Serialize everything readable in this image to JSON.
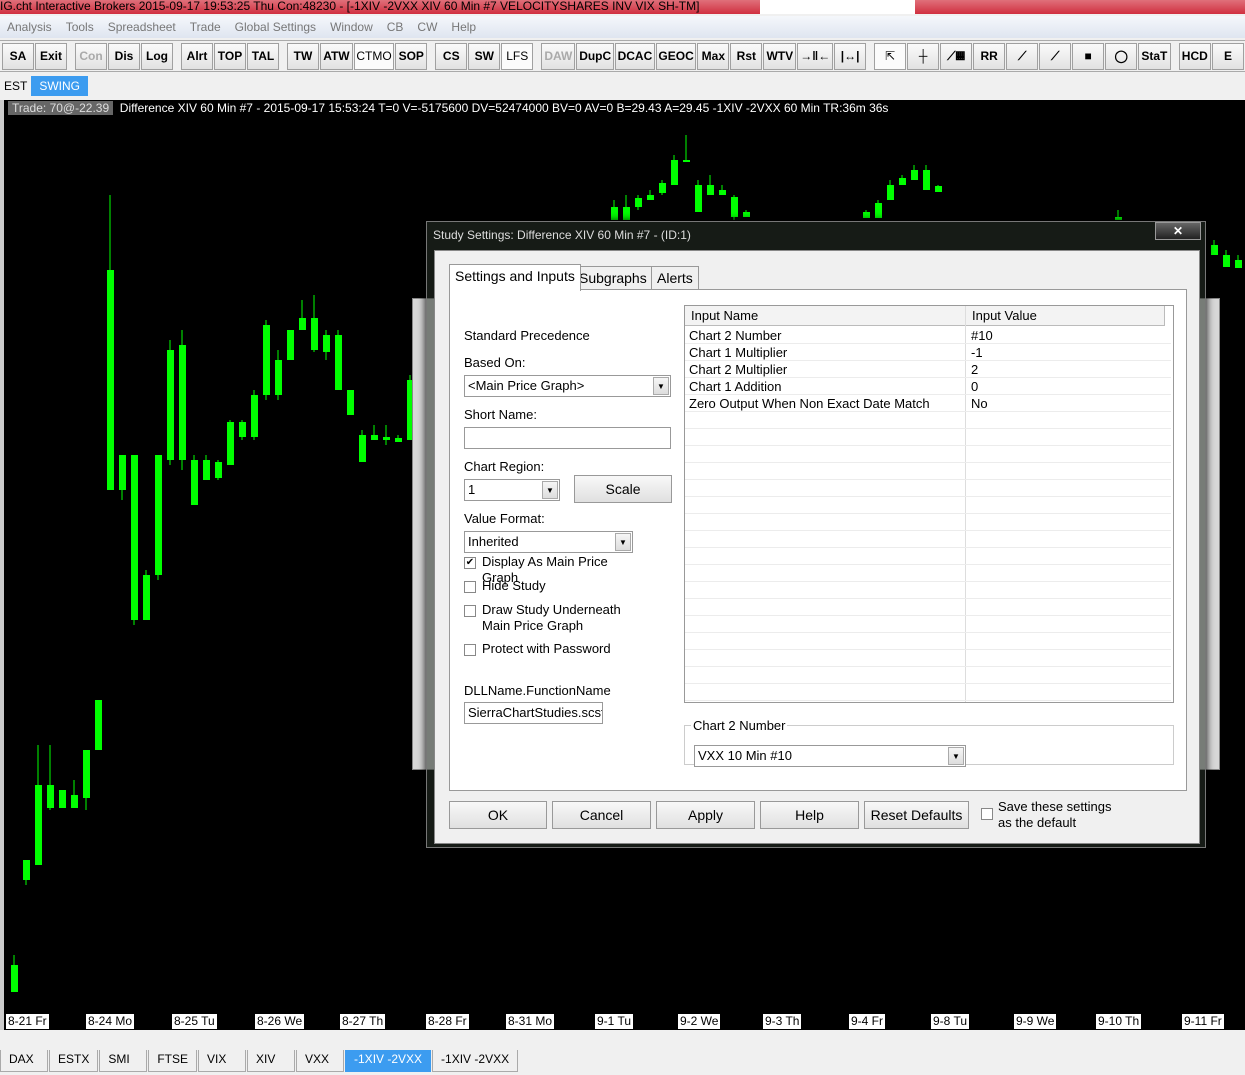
{
  "window": {
    "title": "IG.cht  Interactive Brokers 2015-09-17  19:53:25 Thu  Con:48230 - [-1XIV -2VXX  XIV  60 Min   #7  VELOCITYSHARES INV VIX SH-TM]"
  },
  "menu": [
    "Analysis",
    "Tools",
    "Spreadsheet",
    "Trade",
    "Global Settings",
    "Window",
    "CB",
    "CW",
    "Help"
  ],
  "toolbar": [
    {
      "label": "SA"
    },
    {
      "label": "Exit"
    },
    {
      "label": "Con",
      "dim": true,
      "gap": true
    },
    {
      "label": "Dis"
    },
    {
      "label": "Log"
    },
    {
      "label": "Alrt",
      "gap": true
    },
    {
      "label": "TOP"
    },
    {
      "label": "TAL"
    },
    {
      "label": "TW",
      "gap": true
    },
    {
      "label": "ATW"
    },
    {
      "label": "CTMO",
      "pressed": true
    },
    {
      "label": "SOP"
    },
    {
      "label": "CS",
      "gap": true
    },
    {
      "label": "SW"
    },
    {
      "label": "LFS",
      "pressed": true
    },
    {
      "label": "DAW",
      "dim": true,
      "gap": true
    },
    {
      "label": "DupC"
    },
    {
      "label": "DCAC"
    },
    {
      "label": "GEOC"
    },
    {
      "label": "Max"
    },
    {
      "label": "Rst"
    },
    {
      "label": "WTV"
    },
    {
      "icon": "compress-bars-icon",
      "glyph": "→‖←"
    },
    {
      "icon": "expand-bars-icon",
      "glyph": "|↔|"
    },
    {
      "icon": "pointer-icon",
      "glyph": "⇱",
      "gap": true,
      "pressed": true
    },
    {
      "icon": "crosshair-icon",
      "glyph": "┼"
    },
    {
      "icon": "calculator-line-icon",
      "glyph": "⟋▦"
    },
    {
      "label": "RR"
    },
    {
      "icon": "line-tool-icon",
      "glyph": "⟋"
    },
    {
      "icon": "ray-tool-icon",
      "glyph": "⟋"
    },
    {
      "icon": "rectangle-tool-icon",
      "glyph": "■"
    },
    {
      "icon": "ellipse-tool-icon",
      "glyph": "◯"
    },
    {
      "label": "StaT"
    },
    {
      "label": "HCD",
      "gap": true
    },
    {
      "label": "E"
    }
  ],
  "chartbook_tabs": [
    {
      "label": "EST",
      "active": false
    },
    {
      "label": "SWING",
      "active": true
    }
  ],
  "infobar": {
    "trade": "Trade: 70@-22.39",
    "text": "Difference XIV  60 Min   #7 -  2015-09-17 15:53:24 T=0 V=-5175600 DV=52474000 BV=0 AV=0 B=29.43 A=29.45 -1XIV -2VXX 60 Min  TR:36m 36s"
  },
  "colors": {
    "candle": "#00ff00",
    "background": "#000000",
    "active_tab": "#3c9cf0"
  },
  "chart_data": {
    "type": "candlestick",
    "note": "OHLC in relative price units; values [index, high, bodyTop, bodyBottom, low]",
    "candles": [
      [
        0,
        5.5,
        4.5,
        1.8,
        1.8
      ],
      [
        1,
        15,
        15,
        13,
        12.5
      ],
      [
        2,
        26.5,
        22.5,
        14.5,
        14.5
      ],
      [
        3,
        26.5,
        22.5,
        20.2,
        20
      ],
      [
        4,
        22,
        22,
        20.2,
        20.2
      ],
      [
        5,
        23,
        21.5,
        20.2,
        20.2
      ],
      [
        6,
        26,
        26,
        21.2,
        20
      ],
      [
        7,
        31,
        31,
        26,
        26
      ],
      [
        8,
        81.5,
        74,
        52,
        52
      ],
      [
        9,
        55.5,
        55.5,
        52,
        51
      ],
      [
        10,
        55.5,
        55.5,
        39,
        38.5
      ],
      [
        11,
        44,
        43.5,
        39,
        39
      ],
      [
        12,
        55.5,
        55.5,
        43.5,
        43
      ],
      [
        13,
        67,
        66,
        55,
        54.5
      ],
      [
        14,
        68,
        66.5,
        55,
        54
      ],
      [
        15,
        55.5,
        55,
        50.5,
        50.5
      ],
      [
        16,
        55.5,
        55,
        53,
        53
      ],
      [
        17,
        55,
        54.8,
        53.2,
        53
      ],
      [
        18,
        59,
        58.8,
        54.5,
        54.5
      ],
      [
        19,
        59,
        58.8,
        57.3,
        57
      ],
      [
        20,
        62,
        61.5,
        57.3,
        57
      ],
      [
        21,
        69,
        68.5,
        61.5,
        61
      ],
      [
        22,
        66,
        65,
        61.5,
        61
      ],
      [
        23,
        68,
        68,
        65,
        65
      ],
      [
        24,
        71,
        69.2,
        68,
        68
      ],
      [
        25,
        71.5,
        69.2,
        66,
        65.8
      ],
      [
        26,
        68,
        67.5,
        65.8,
        65
      ],
      [
        27,
        68,
        67.5,
        62,
        62
      ],
      [
        28,
        62,
        62,
        59.5,
        59.5
      ],
      [
        29,
        58,
        57.5,
        54.8,
        54.8
      ],
      [
        30,
        58.5,
        57.5,
        57,
        57
      ],
      [
        31,
        58.5,
        57.3,
        57,
        56.5
      ],
      [
        32,
        57.5,
        57.2,
        56.8,
        56.8
      ],
      [
        33,
        63.5,
        63,
        57,
        57
      ],
      [
        50,
        81,
        80.3,
        79,
        79
      ],
      [
        51,
        81.5,
        80.3,
        79,
        79
      ],
      [
        52,
        81.5,
        81.2,
        80.3,
        80
      ],
      [
        53,
        82,
        81.5,
        81,
        81
      ],
      [
        54,
        83,
        82.7,
        81.7,
        81.5
      ],
      [
        55,
        85.5,
        85,
        82.5,
        82.5
      ],
      [
        56,
        87.5,
        85,
        85,
        85
      ],
      [
        57,
        83,
        82.5,
        79.8,
        79.8
      ],
      [
        58,
        83.5,
        82.5,
        81.5,
        81.5
      ],
      [
        59,
        82.5,
        82,
        81.5,
        81.5
      ],
      [
        60,
        81.5,
        81.3,
        79.3,
        79
      ],
      [
        61,
        80,
        79.8,
        79.3,
        79.3
      ],
      [
        71,
        80,
        79.8,
        79.2,
        79.2
      ],
      [
        72,
        81,
        80.7,
        79.2,
        79.2
      ],
      [
        73,
        83,
        82.5,
        81,
        81
      ],
      [
        74,
        83.5,
        83.2,
        82.5,
        82.5
      ],
      [
        75,
        84.5,
        84,
        83,
        83
      ],
      [
        76,
        84.5,
        84,
        82,
        82
      ],
      [
        77,
        82.5,
        82.4,
        81.8,
        81.8
      ],
      [
        92,
        80,
        79.3,
        79,
        79
      ],
      [
        100,
        77,
        76.5,
        75.5,
        75.5
      ],
      [
        101,
        76,
        75.5,
        74.3,
        74.3
      ],
      [
        102,
        75.5,
        75,
        74.2,
        74.2
      ]
    ],
    "x_tick_labels": [
      "8-21 Fr",
      "8-24 Mo",
      "8-25 Tu",
      "8-26 We",
      "8-27 Th",
      "8-28 Fr",
      "8-31 Mo",
      "9-1 Tu",
      "9-2 We",
      "9-3 Th",
      "9-4 Fr",
      "9-8 Tu",
      "9-9 We",
      "9-10 Th",
      "9-11 Fr"
    ]
  },
  "bottom_tabs": [
    {
      "label": "DAX"
    },
    {
      "label": "ESTX"
    },
    {
      "label": "SMI"
    },
    {
      "label": "FTSE"
    },
    {
      "label": "VIX"
    },
    {
      "label": "XIV"
    },
    {
      "label": "VXX"
    },
    {
      "label": "-1XIV -2VXX",
      "active": true
    },
    {
      "label": "-1XIV -2VXX"
    }
  ],
  "dialog": {
    "title": "Study Settings: Difference XIV  60 Min   #7 -  (ID:1)",
    "close": "✕",
    "tabs": [
      "Settings and Inputs",
      "Subgraphs",
      "Alerts"
    ],
    "standard_precedence": "Standard Precedence",
    "based_on_label": "Based On:",
    "based_on_value": "<Main Price Graph>",
    "short_name_label": "Short Name:",
    "short_name_value": "",
    "chart_region_label": "Chart Region:",
    "chart_region_value": "1",
    "scale_button": "Scale",
    "value_format_label": "Value Format:",
    "value_format_value": "Inherited",
    "checkboxes": [
      {
        "label": "Display As Main Price Graph",
        "checked": true
      },
      {
        "label": "Hide Study",
        "checked": false
      },
      {
        "label": "Draw Study Underneath Main Price Graph",
        "checked": false
      },
      {
        "label": "Protect with Password",
        "checked": false
      }
    ],
    "dll_label": "DLLName.FunctionName",
    "dll_value": "SierraChartStudies.scsf",
    "table": {
      "headers": [
        "Input Name",
        "Input Value"
      ],
      "rows": [
        [
          "Chart 2 Number",
          "#10"
        ],
        [
          "Chart 1 Multiplier",
          "-1"
        ],
        [
          "Chart 2 Multiplier",
          "2"
        ],
        [
          "Chart 1 Addition",
          "0"
        ],
        [
          "Zero Output When Non Exact Date Match",
          "No"
        ]
      ]
    },
    "group_label": "Chart 2 Number",
    "group_value": "VXX  10 Min   #10",
    "buttons": [
      "OK",
      "Cancel",
      "Apply",
      "Help",
      "Reset Defaults"
    ],
    "save_default": {
      "label": "Save these settings as the default",
      "checked": false
    }
  }
}
